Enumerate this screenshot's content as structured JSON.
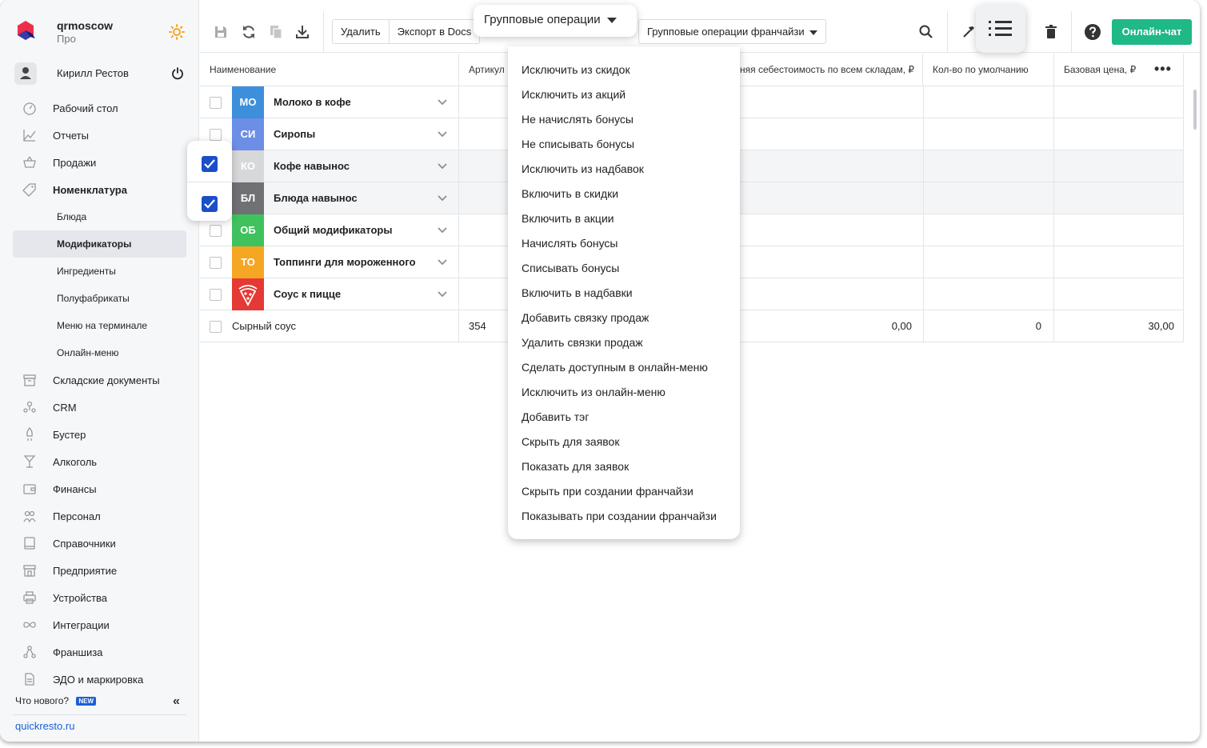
{
  "brand": {
    "name": "qrmoscow",
    "plan": "Про"
  },
  "user": {
    "name": "Кирилл Рестов"
  },
  "nav": {
    "desktop": "Рабочий стол",
    "reports": "Отчеты",
    "sales": "Продажи",
    "nomenclature": "Номенклатура",
    "sub": {
      "dishes": "Блюда",
      "modifiers": "Модификаторы",
      "ingredients": "Ингредиенты",
      "semi": "Полуфабрикаты",
      "terminal_menu": "Меню на терминале",
      "online_menu": "Онлайн-меню"
    },
    "warehouse": "Складские документы",
    "crm": "CRM",
    "booster": "Бустер",
    "alcohol": "Алкоголь",
    "finance": "Финансы",
    "staff": "Персонал",
    "refs": "Справочники",
    "enterprise": "Предприятие",
    "devices": "Устройства",
    "integrations": "Интеграции",
    "franchise": "Франшиза",
    "edo": "ЭДО и маркировка"
  },
  "footer": {
    "whats_new": "Что нового?",
    "new_badge": "NEW",
    "site": "quickresto.ru"
  },
  "toolbar": {
    "delete": "Удалить",
    "export": "Экспорт в Docs",
    "group_ops": "Групповые операции",
    "franchise_ops": "Групповые операции франчайзи",
    "chat": "Онлайн-чат"
  },
  "table": {
    "headers": {
      "name": "Наименование",
      "article": "Артикул",
      "cost": "Средняя себестоимость по всем складам, ₽",
      "qty": "Кол-во по умолчанию",
      "price": "Базовая цена, ₽"
    },
    "groups": [
      {
        "abbr": "МО",
        "name": "Молоко в кофе",
        "color": "#3d8fdc"
      },
      {
        "abbr": "СИ",
        "name": "Сиропы",
        "color": "#6d8ee6"
      },
      {
        "abbr": "КО",
        "name": "Кофе навынос",
        "color": "#d7d8da"
      },
      {
        "abbr": "БЛ",
        "name": "Блюда навынос",
        "color": "#6f7175"
      },
      {
        "abbr": "ОБ",
        "name": "Общий модификаторы",
        "color": "#3fc25d"
      },
      {
        "abbr": "ТО",
        "name": "Топпинги для мороженного",
        "color": "#f5a623"
      },
      {
        "abbr": "pizza-icon",
        "name": "Соус к пицце",
        "color": "#e53935"
      }
    ],
    "item": {
      "name": "Сырный соус",
      "article": "354",
      "cost": "0,00",
      "qty": "0",
      "price": "30,00"
    }
  },
  "menu": {
    "items": [
      "Исключить из скидок",
      "Исключить из акций",
      "Не начислять бонусы",
      "Не списывать бонусы",
      "Исключить из надбавок",
      "Включить в скидки",
      "Включить в акции",
      "Начислять бонусы",
      "Списывать бонусы",
      "Включить в надбавки",
      "Добавить связку продаж",
      "Удалить связки продаж",
      "Сделать доступным в онлайн-меню",
      "Исключить из онлайн-меню",
      "Добавить тэг",
      "Скрыть для заявок",
      "Показать для заявок",
      "Скрыть при создании франчайзи",
      "Показывать при создании франчайзи"
    ]
  },
  "colors": {
    "accent": "#1a4fc9",
    "chat": "#1fb886",
    "link": "#1a5fd6"
  }
}
